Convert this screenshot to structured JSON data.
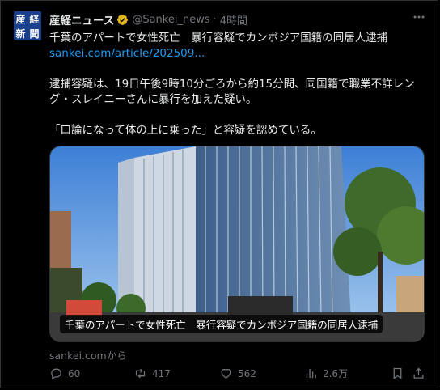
{
  "tweet": {
    "author_name": "産経ニュース",
    "handle": "@Sankei_news",
    "dot": "·",
    "time": "4時間",
    "avatar_chars": [
      "産",
      "経",
      "新",
      "聞"
    ],
    "headline": "千葉のアパートで女性死亡　暴行容疑でカンボジア国籍の同居人逮捕",
    "link": "sankei.com/article/202509...",
    "paragraph1": "逮捕容疑は、19日午後9時10分ごろから約15分間、同国籍で職業不詳レング・スレイニーさんに暴行を加えた疑い。",
    "paragraph2": "「口論になって体の上に乗った」と容疑を認めている。",
    "card_title": "千葉のアパートで女性死亡　暴行容疑でカンボジア国籍の同居人逮捕",
    "source": "sankei.comから"
  },
  "actions": {
    "replies": "60",
    "reposts": "417",
    "likes": "562",
    "views": "2.6万"
  },
  "colors": {
    "background": "#000000",
    "text": "#e7e9ea",
    "muted": "#71767b",
    "link": "#1d9bf0",
    "verified": "#e2b719"
  },
  "icons": {
    "verified": "verified-badge-icon",
    "more": "more-options-icon",
    "reply": "reply-icon",
    "repost": "repost-icon",
    "like": "heart-icon",
    "views": "views-chart-icon",
    "bookmark": "bookmark-icon",
    "share": "share-icon"
  }
}
